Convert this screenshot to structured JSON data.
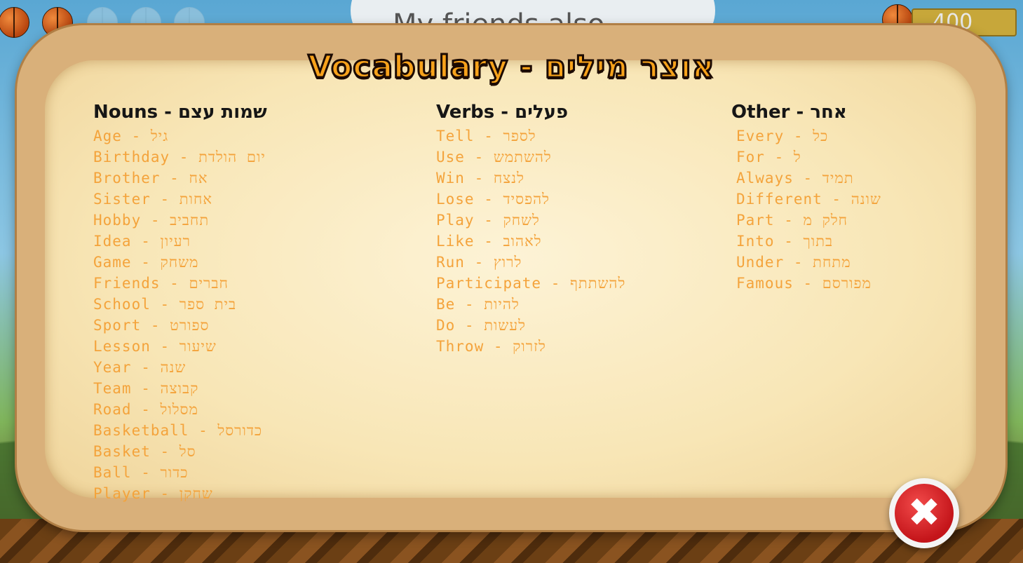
{
  "background": {
    "cloud_text": "My friends also",
    "score": "400"
  },
  "title": "Vocabulary - אוצר מילים",
  "columns": [
    {
      "heading": "Nouns - שמות עצם",
      "items": [
        "Age - גיל",
        "Birthday - יום הולדת",
        "Brother - אח",
        "Sister - אחות",
        "Hobby - תחביב",
        "Idea - רעיון",
        "Game - משחק",
        "Friends - חברים",
        "School - בית ספר",
        "Sport - ספורט",
        "Lesson - שיעור",
        "Year - שנה",
        "Team - קבוצה",
        "Road - מסלול",
        "Basketball - כדורסל",
        "Basket - סל",
        "Ball - כדור",
        "Player - שחקן"
      ]
    },
    {
      "heading": "Verbs - פעלים",
      "items": [
        "Tell - לספר",
        "Use - להשתמש",
        "Win - לנצח",
        "Lose - להפסיד",
        "Play - לשחק",
        "Like - לאהוב",
        "Run - לרוץ",
        "Participate - להשתתף",
        "Be - להיות",
        "Do - לעשות",
        "Throw - לזרוק"
      ]
    },
    {
      "heading": "Other - אחר",
      "items": [
        "Every - כל",
        "For - ל",
        "Always - תמיד",
        "Different - שונה",
        "Part - חלק מ",
        "Into - בתוך",
        "Under - מתחת",
        "Famous - מפורסם"
      ]
    }
  ],
  "close_button": {
    "icon": "close-x-icon",
    "color": "#d61f24"
  },
  "colors": {
    "item": "#f4a33b",
    "heading": "#161616",
    "title_fill": "#f7a21b"
  }
}
